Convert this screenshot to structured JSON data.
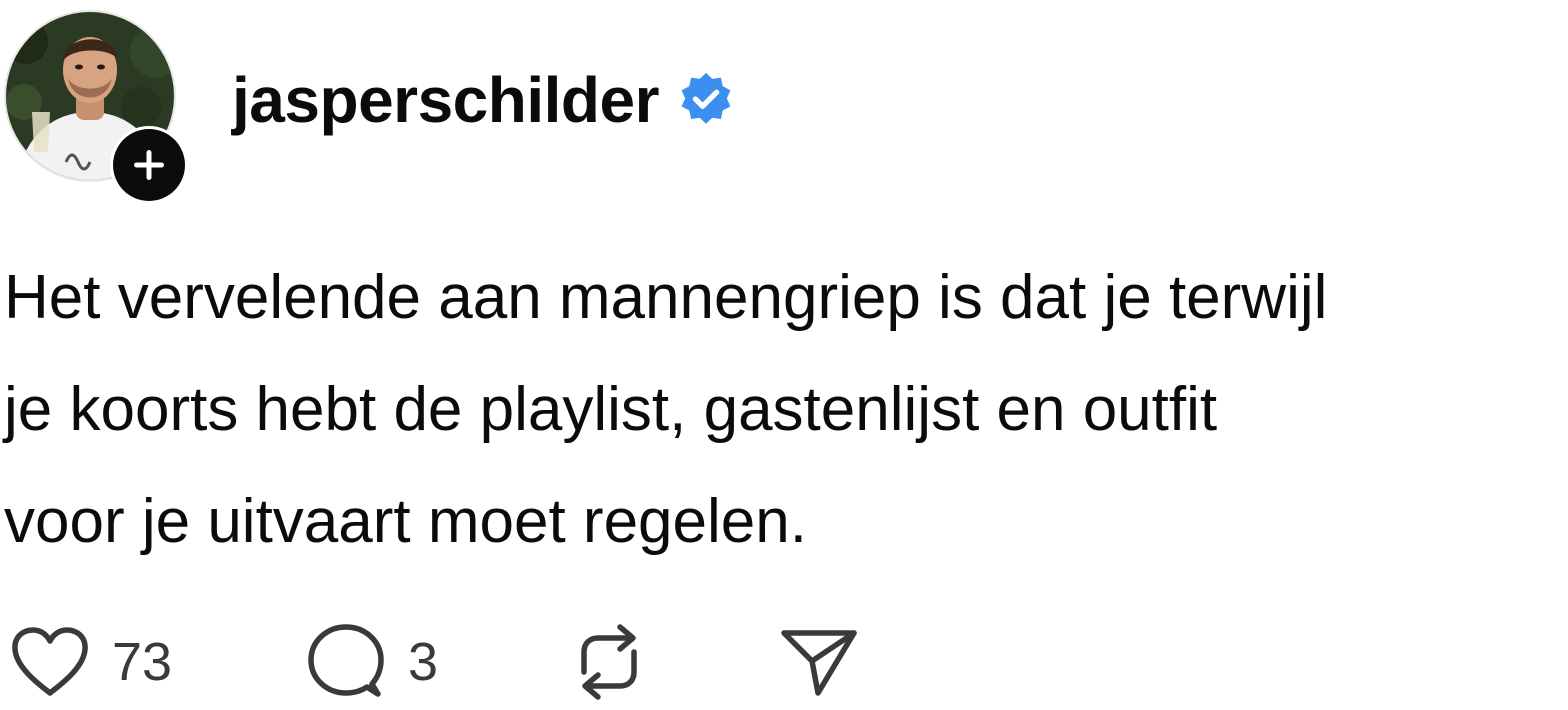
{
  "post": {
    "author": {
      "username": "jasperschilder",
      "verified": true,
      "verified_color": "#3b8ff0",
      "avatar_icon": "profile-photo",
      "follow_icon": "plus-icon"
    },
    "text": "Het vervelende aan mannengriep is dat je terwijl\nje koorts hebt de playlist, gastenlijst en outfit\nvoor je uitvaart moet regelen.",
    "actions": {
      "like_count": "73",
      "reply_count": "3",
      "like_icon": "heart-icon",
      "reply_icon": "comment-bubble-icon",
      "repost_icon": "repost-icon",
      "share_icon": "send-icon"
    }
  }
}
